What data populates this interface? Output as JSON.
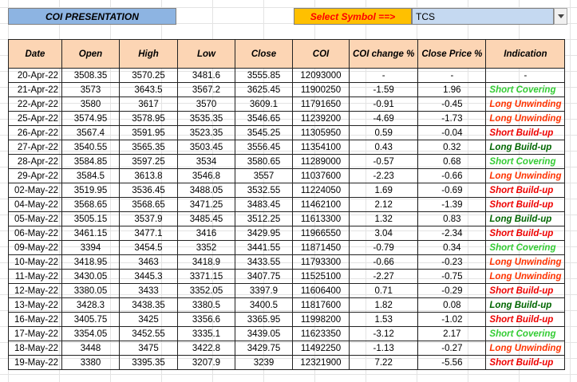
{
  "title": "COI PRESENTATION",
  "select": {
    "label": "Select Symbol ==>",
    "value": "TCS"
  },
  "colors": {
    "header_bg": "#fcd5b4",
    "title_bg": "#8db4e2",
    "select_label_bg": "#ffc000",
    "select_label_text": "#ff0000",
    "select_box_bg": "#c5d9f1"
  },
  "indication_colors": {
    "Short Covering": "#33cc33",
    "Long Unwinding": "#ff3300",
    "Short Build-up": "#ee0000",
    "Long Build-up": "#006600",
    "-": "#000000"
  },
  "table": {
    "headers": [
      "Date",
      "Open",
      "High",
      "Low",
      "Close",
      "COI",
      "COI change %",
      "Close Price %",
      "Indication"
    ],
    "rows": [
      [
        "20-Apr-22",
        "3508.35",
        "3570.25",
        "3481.6",
        "3555.85",
        "12093000",
        "-",
        "-",
        "-"
      ],
      [
        "21-Apr-22",
        "3573",
        "3643.5",
        "3567.2",
        "3625.45",
        "11900250",
        "-1.59",
        "1.96",
        "Short Covering"
      ],
      [
        "22-Apr-22",
        "3580",
        "3617",
        "3570",
        "3609.1",
        "11791650",
        "-0.91",
        "-0.45",
        "Long Unwinding"
      ],
      [
        "25-Apr-22",
        "3574.95",
        "3578.95",
        "3535.35",
        "3546.65",
        "11239200",
        "-4.69",
        "-1.73",
        "Long Unwinding"
      ],
      [
        "26-Apr-22",
        "3567.4",
        "3591.95",
        "3523.35",
        "3545.25",
        "11305950",
        "0.59",
        "-0.04",
        "Short Build-up"
      ],
      [
        "27-Apr-22",
        "3540.55",
        "3565.35",
        "3503.45",
        "3556.45",
        "11354100",
        "0.43",
        "0.32",
        "Long Build-up"
      ],
      [
        "28-Apr-22",
        "3584.85",
        "3597.25",
        "3534",
        "3580.65",
        "11289000",
        "-0.57",
        "0.68",
        "Short Covering"
      ],
      [
        "29-Apr-22",
        "3584.5",
        "3613.8",
        "3546.8",
        "3557",
        "11037600",
        "-2.23",
        "-0.66",
        "Long Unwinding"
      ],
      [
        "02-May-22",
        "3519.95",
        "3536.45",
        "3488.05",
        "3532.55",
        "11224050",
        "1.69",
        "-0.69",
        "Short Build-up"
      ],
      [
        "04-May-22",
        "3568.65",
        "3568.65",
        "3471.25",
        "3483.45",
        "11462100",
        "2.12",
        "-1.39",
        "Short Build-up"
      ],
      [
        "05-May-22",
        "3505.15",
        "3537.9",
        "3485.45",
        "3512.25",
        "11613300",
        "1.32",
        "0.83",
        "Long Build-up"
      ],
      [
        "06-May-22",
        "3461.15",
        "3477.1",
        "3416",
        "3429.95",
        "11966550",
        "3.04",
        "-2.34",
        "Short Build-up"
      ],
      [
        "09-May-22",
        "3394",
        "3454.5",
        "3352",
        "3441.55",
        "11871450",
        "-0.79",
        "0.34",
        "Short Covering"
      ],
      [
        "10-May-22",
        "3418.95",
        "3463",
        "3418.9",
        "3433.55",
        "11793300",
        "-0.66",
        "-0.23",
        "Long Unwinding"
      ],
      [
        "11-May-22",
        "3430.05",
        "3445.3",
        "3371.15",
        "3407.75",
        "11525100",
        "-2.27",
        "-0.75",
        "Long Unwinding"
      ],
      [
        "12-May-22",
        "3380.05",
        "3433",
        "3352.05",
        "3397.9",
        "11606400",
        "0.71",
        "-0.29",
        "Short Build-up"
      ],
      [
        "13-May-22",
        "3428.3",
        "3438.35",
        "3380.5",
        "3400.5",
        "11817600",
        "1.82",
        "0.08",
        "Long Build-up"
      ],
      [
        "16-May-22",
        "3405.75",
        "3425",
        "3356.6",
        "3365.95",
        "11998200",
        "1.53",
        "-1.02",
        "Short Build-up"
      ],
      [
        "17-May-22",
        "3354.05",
        "3452.55",
        "3335.1",
        "3439.05",
        "11623350",
        "-3.12",
        "2.17",
        "Short Covering"
      ],
      [
        "18-May-22",
        "3448",
        "3475",
        "3422.8",
        "3429.75",
        "11492250",
        "-1.13",
        "-0.27",
        "Long Unwinding"
      ],
      [
        "19-May-22",
        "3380",
        "3395.35",
        "3207.9",
        "3239",
        "12321900",
        "7.22",
        "-5.56",
        "Short Build-up"
      ]
    ]
  }
}
